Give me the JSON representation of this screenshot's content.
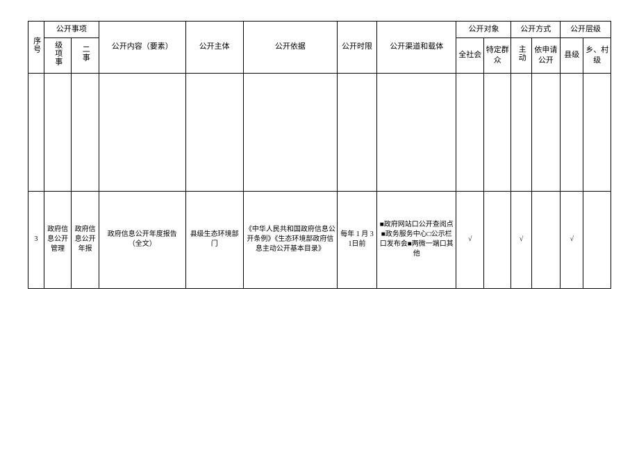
{
  "headers": {
    "seq": "序号",
    "matter": "公开事项",
    "matter_lvl1": "级项事",
    "matter_lvl2": "二事",
    "content": "公开内容（要素）",
    "subject": "公开主体",
    "basis": "公开依据",
    "time": "公开时限",
    "channel": "公开渠道和载体",
    "target": "公开对象",
    "target_all": "全社会",
    "target_spec": "特定群众",
    "method": "公开方式",
    "method_active": "主动",
    "method_apply": "依申请公开",
    "level": "公开层级",
    "level_county": "县级",
    "level_village": "乡、村级"
  },
  "row": {
    "seq": "3",
    "lvl1": "政府信息公开管理",
    "lvl2": "政府信息公开年报",
    "content": "政府信息公开年度报告（全文）",
    "subject": "县级生态环境部门",
    "basis": "《中华人民共和国政府信息公开条例》《生态环境部政府信息主动公开基本目录》",
    "time": "每年 1 月 31日前",
    "channel": "■政府网站口公开查阅点■政务服务中心□公示栏口发布会■两微一端口其他",
    "target_all": "√",
    "target_spec": "",
    "method_active": "√",
    "method_apply": "",
    "level_county": "√",
    "level_village": ""
  }
}
